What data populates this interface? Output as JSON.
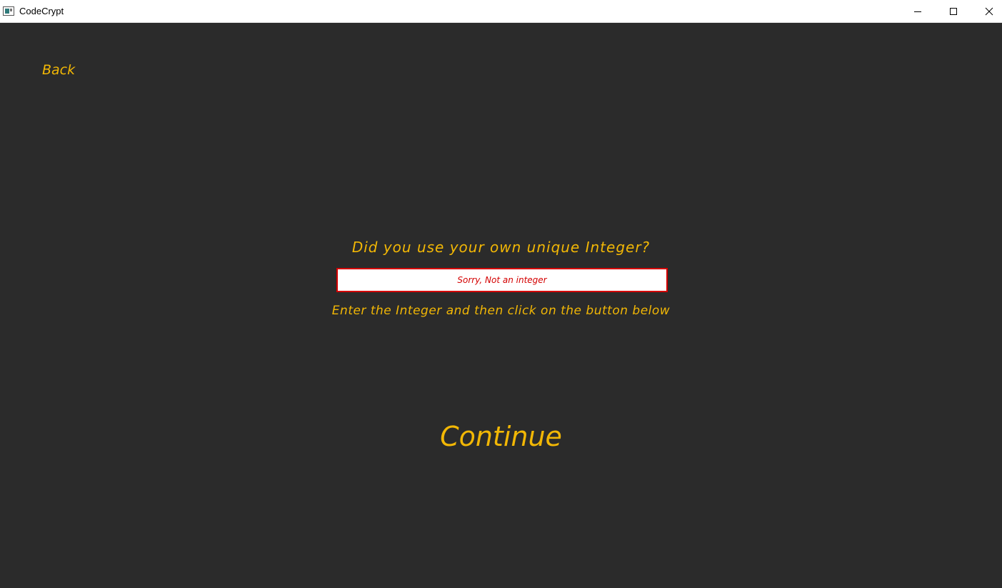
{
  "window": {
    "title": "CodeCrypt",
    "controls": {
      "minimize_icon": "minimize-icon",
      "maximize_icon": "maximize-icon",
      "close_icon": "close-icon"
    }
  },
  "page": {
    "back_label": "Back",
    "question": "Did you use your own unique Integer?",
    "input": {
      "value": "Sorry, Not an integer",
      "state": "error"
    },
    "hint": "Enter the Integer and then click on the button below",
    "continue_label": "Continue"
  },
  "colors": {
    "background": "#2b2b2b",
    "accent_text": "#f2b705",
    "error": "#d40000",
    "input_background": "#ffffff",
    "titlebar": "#ffffff"
  }
}
